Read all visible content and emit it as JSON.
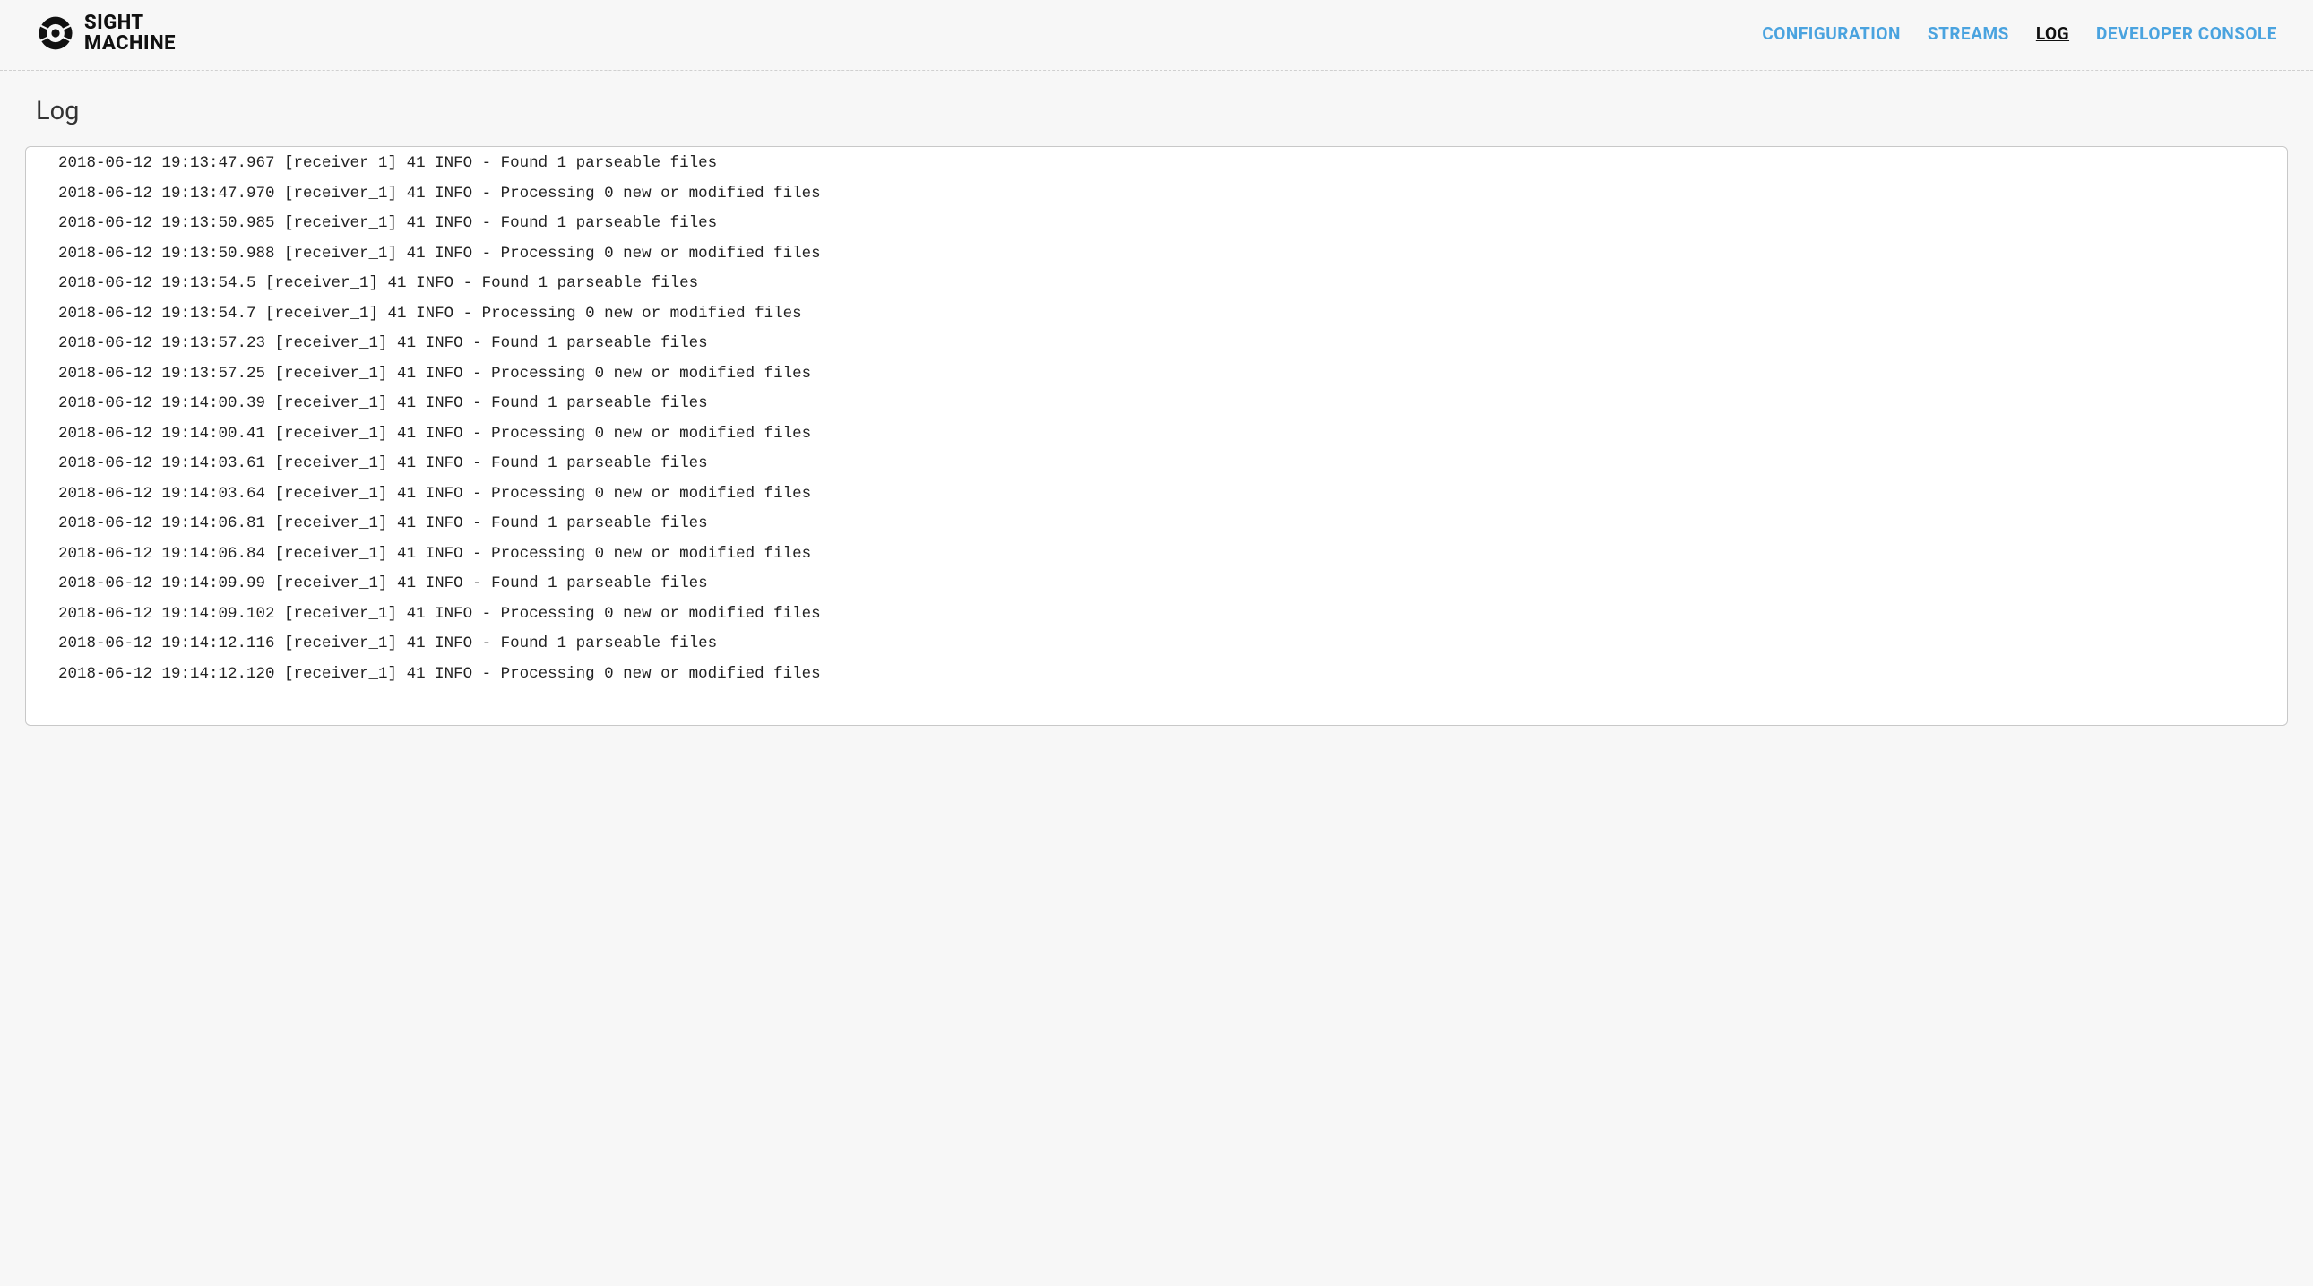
{
  "brand": {
    "line1": "SIGHT",
    "line2": "MACHINE"
  },
  "nav": {
    "items": [
      {
        "label": "CONFIGURATION",
        "active": false
      },
      {
        "label": "STREAMS",
        "active": false
      },
      {
        "label": "LOG",
        "active": true
      },
      {
        "label": "DEVELOPER CONSOLE",
        "active": false
      }
    ]
  },
  "page": {
    "title": "Log"
  },
  "log": {
    "lines": [
      "2018-06-12 19:13:47.967 [receiver_1] 41 INFO - Found 1 parseable files",
      "2018-06-12 19:13:47.970 [receiver_1] 41 INFO - Processing 0 new or modified files",
      "2018-06-12 19:13:50.985 [receiver_1] 41 INFO - Found 1 parseable files",
      "2018-06-12 19:13:50.988 [receiver_1] 41 INFO - Processing 0 new or modified files",
      "2018-06-12 19:13:54.5 [receiver_1] 41 INFO - Found 1 parseable files",
      "2018-06-12 19:13:54.7 [receiver_1] 41 INFO - Processing 0 new or modified files",
      "2018-06-12 19:13:57.23 [receiver_1] 41 INFO - Found 1 parseable files",
      "2018-06-12 19:13:57.25 [receiver_1] 41 INFO - Processing 0 new or modified files",
      "2018-06-12 19:14:00.39 [receiver_1] 41 INFO - Found 1 parseable files",
      "2018-06-12 19:14:00.41 [receiver_1] 41 INFO - Processing 0 new or modified files",
      "2018-06-12 19:14:03.61 [receiver_1] 41 INFO - Found 1 parseable files",
      "2018-06-12 19:14:03.64 [receiver_1] 41 INFO - Processing 0 new or modified files",
      "2018-06-12 19:14:06.81 [receiver_1] 41 INFO - Found 1 parseable files",
      "2018-06-12 19:14:06.84 [receiver_1] 41 INFO - Processing 0 new or modified files",
      "2018-06-12 19:14:09.99 [receiver_1] 41 INFO - Found 1 parseable files",
      "2018-06-12 19:14:09.102 [receiver_1] 41 INFO - Processing 0 new or modified files",
      "2018-06-12 19:14:12.116 [receiver_1] 41 INFO - Found 1 parseable files",
      "2018-06-12 19:14:12.120 [receiver_1] 41 INFO - Processing 0 new or modified files"
    ]
  }
}
